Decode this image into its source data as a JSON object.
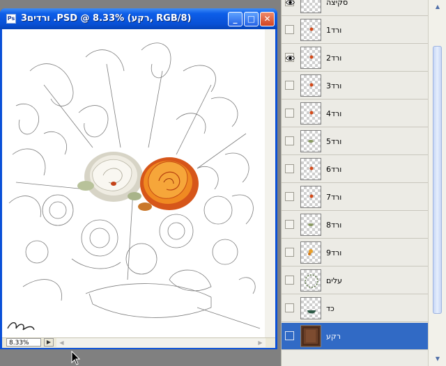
{
  "document": {
    "title": "ורדים3 .PSD @ 8.33% (רקע, RGB/8)",
    "app_icon_label": "Ps",
    "zoom": "8.33%",
    "controls": {
      "minimize": "_",
      "maximize": "□",
      "close": "✕"
    },
    "status_icon": "info-arrow-icon"
  },
  "layers": [
    {
      "name": "סקיצה",
      "visible": true,
      "selected": false,
      "thumb_mark": "none"
    },
    {
      "name": "ורד1",
      "visible": false,
      "selected": false,
      "thumb_mark": "rose"
    },
    {
      "name": "ורד2",
      "visible": true,
      "selected": false,
      "thumb_mark": "rose"
    },
    {
      "name": "ורד3",
      "visible": false,
      "selected": false,
      "thumb_mark": "rose"
    },
    {
      "name": "ורד4",
      "visible": false,
      "selected": false,
      "thumb_mark": "rose"
    },
    {
      "name": "ורד5",
      "visible": false,
      "selected": false,
      "thumb_mark": "leaf"
    },
    {
      "name": "ורד6",
      "visible": false,
      "selected": false,
      "thumb_mark": "rose"
    },
    {
      "name": "ורד7",
      "visible": false,
      "selected": false,
      "thumb_mark": "rose"
    },
    {
      "name": "ורד8",
      "visible": false,
      "selected": false,
      "thumb_mark": "leaf"
    },
    {
      "name": "ורד9",
      "visible": false,
      "selected": false,
      "thumb_mark": "orange"
    },
    {
      "name": "עלים",
      "visible": false,
      "selected": false,
      "thumb_mark": "leaves"
    },
    {
      "name": "כד",
      "visible": false,
      "selected": false,
      "thumb_mark": "vase"
    },
    {
      "name": "רקע",
      "visible": false,
      "selected": true,
      "thumb_mark": "background"
    }
  ],
  "colors": {
    "title_bar": "#0a50d8",
    "selection": "#316ac5",
    "panel_bg": "#ecebe5",
    "rose_orange": "#e8771c",
    "rose_white": "#f4efe6"
  }
}
